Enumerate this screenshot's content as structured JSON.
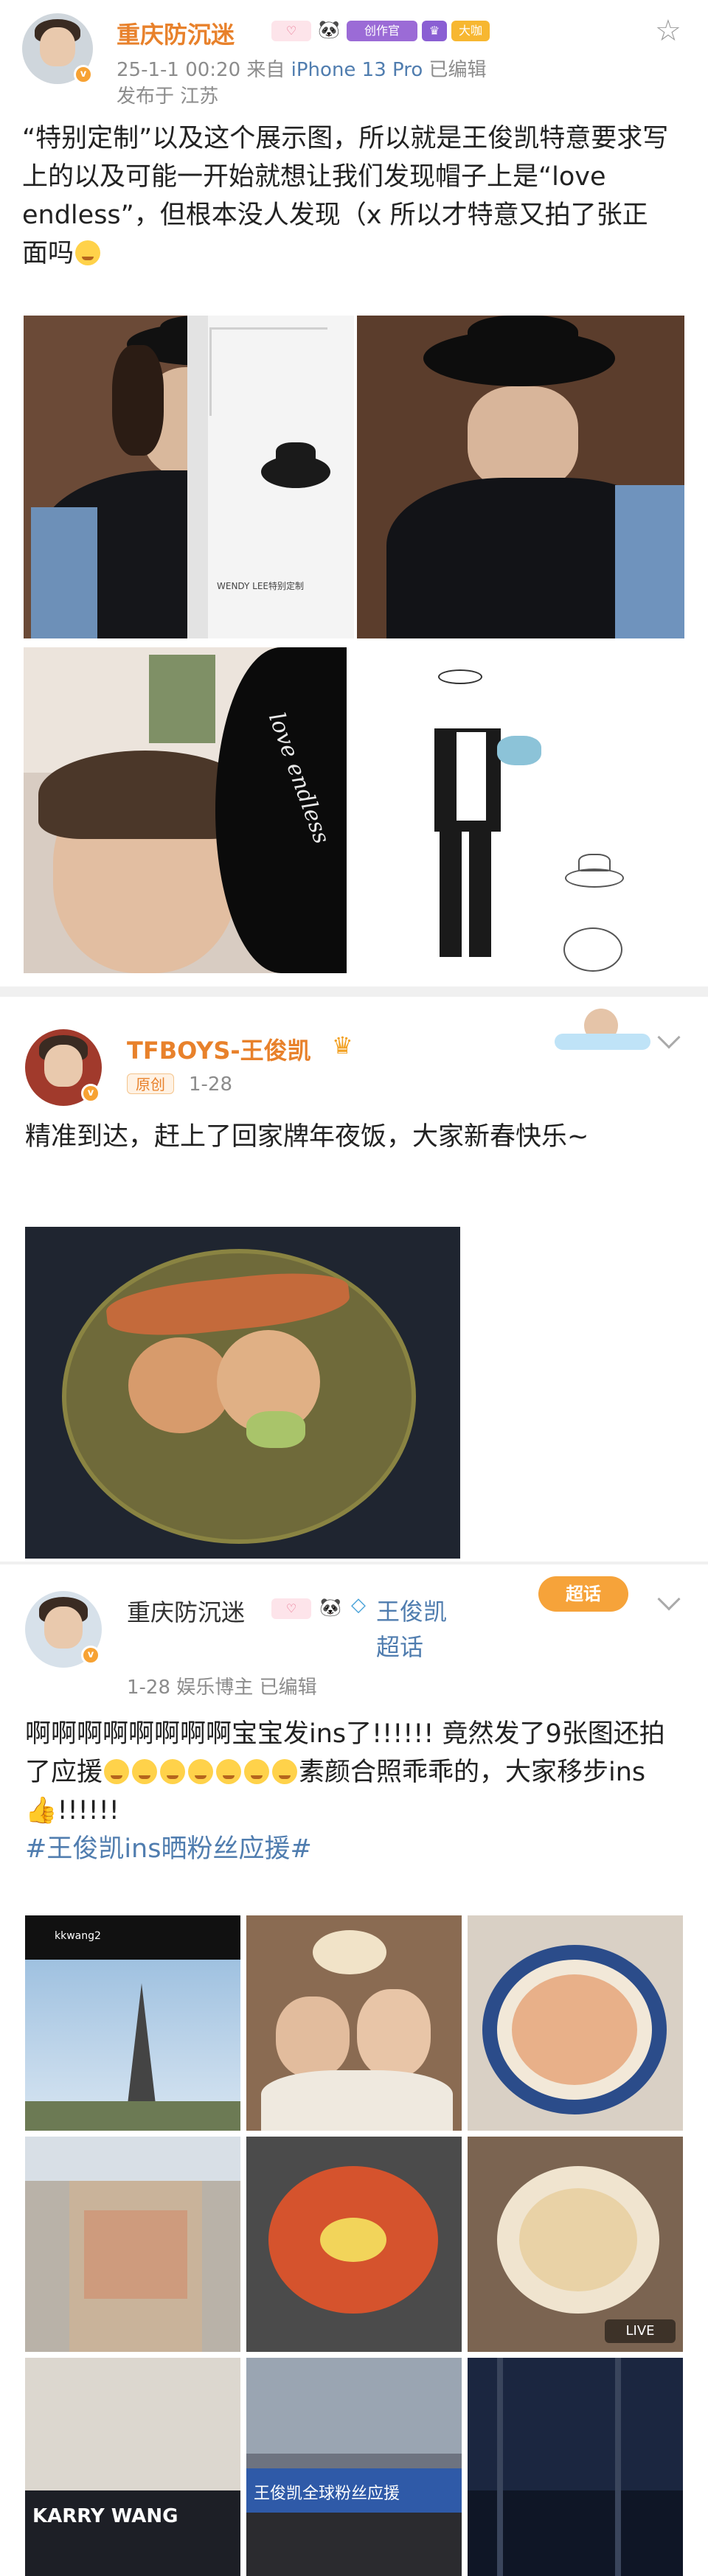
{
  "post1": {
    "username": "重庆防沉迷",
    "badges": [
      "创作官",
      "大咖"
    ],
    "time_device": "25-1-1 00:20  来自 ",
    "device": "iPhone 13 Pro",
    "edited": "已编辑",
    "location": "发布于 江苏",
    "text": "“特别定制”以及这个展示图，所以就是王俊凯特意要求写上的以及可能一开始就想让我们发现帽子上是“love endless”，但根本没人发现（x 所以才特意又拍了张正面吗",
    "sketch_caption": "WENDY LEE特别定制",
    "hat_text": "love endless"
  },
  "post2": {
    "username": "TFBOYS-王俊凯",
    "original_tag": "原创",
    "date": "1-28",
    "text": "精准到达，赶上了回家牌年夜饭，大家新春快乐~"
  },
  "post3": {
    "username": "重庆防沉迷",
    "topic_name": "王俊凯超话",
    "super_tag": "超话",
    "date": "1-28",
    "role": "娱乐博主",
    "edited": "已编辑",
    "text": "啊啊啊啊啊啊啊啊宝宝发ins了!!!!!! 竟然发了9张图还拍了应援",
    "text_mid": "素颜合照乖乖的，大家移步ins",
    "text_end": "!!!!!!",
    "hashtag": "#王俊凯ins晒粉丝应援#",
    "ig_handle": "kkwang2",
    "live_label": "LIVE",
    "banner_text": "KARRY WANG",
    "banner_text2": "王俊凯全球粉丝应援"
  },
  "colors": {
    "name_orange": "#e8812b",
    "topic_blue": "#507daf",
    "meta_gray": "#8c8c8c"
  },
  "icons": [
    "star-icon",
    "vip-badge-icon",
    "chevron-down-icon",
    "super-topic-icon",
    "thumbs-up-icon",
    "crying-emoji-icon"
  ]
}
